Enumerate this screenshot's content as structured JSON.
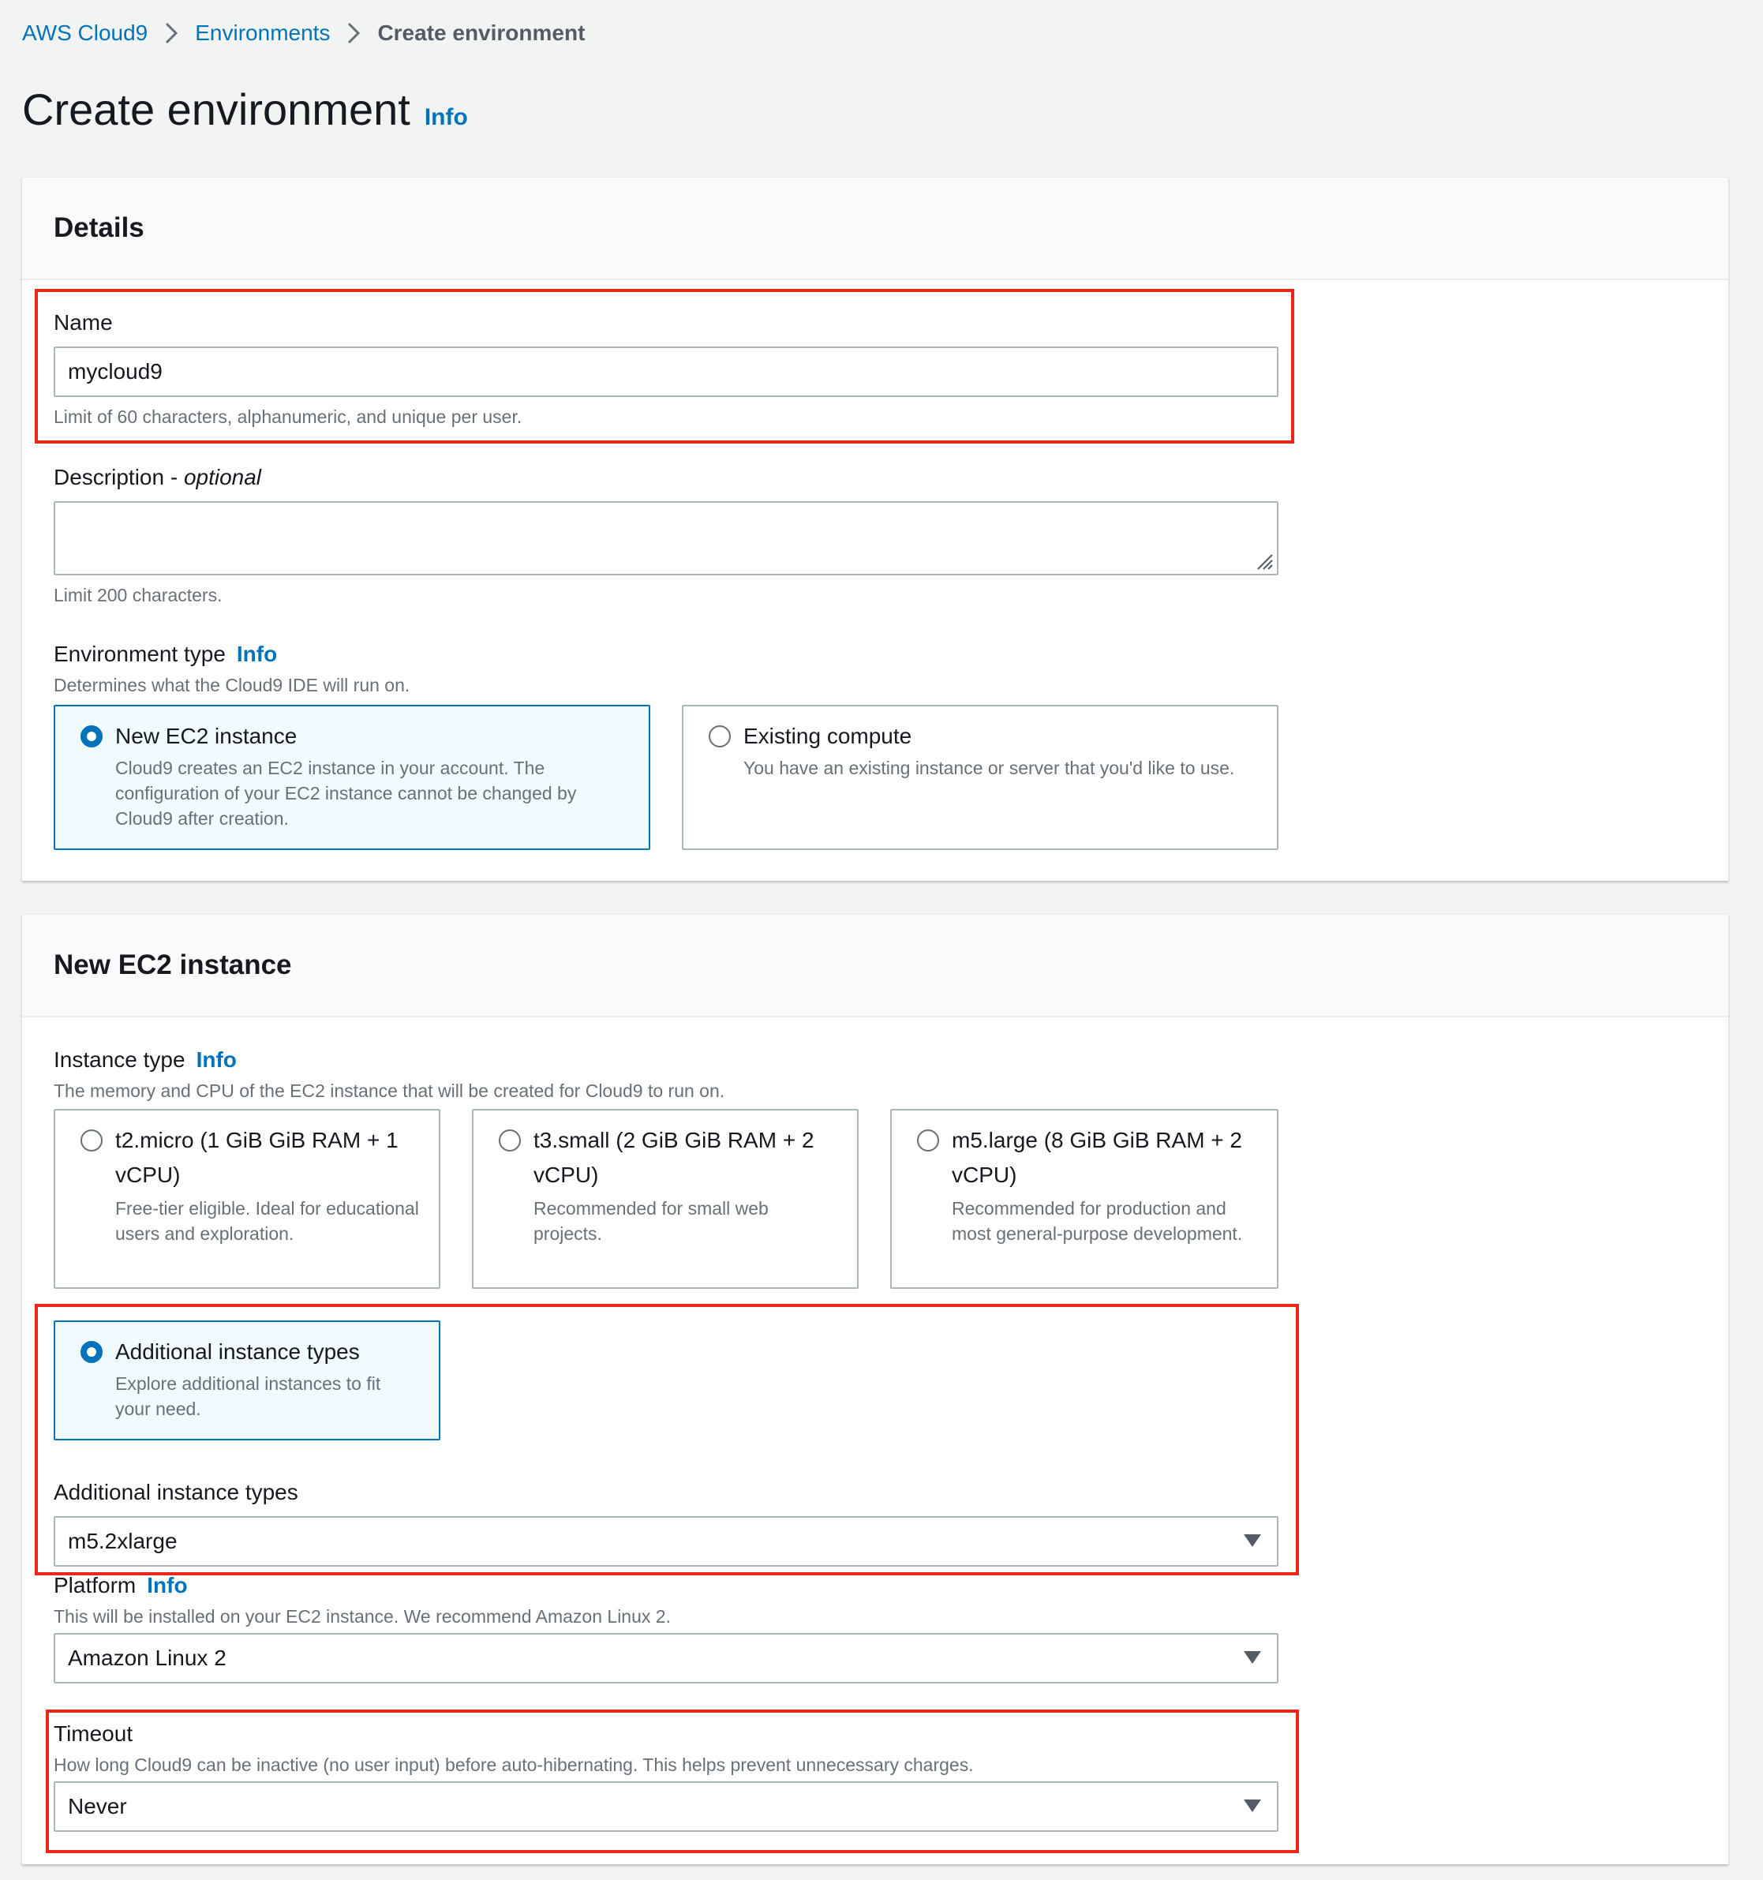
{
  "breadcrumb": {
    "items": [
      "AWS Cloud9",
      "Environments"
    ],
    "current": "Create environment"
  },
  "page": {
    "title": "Create environment",
    "info": "Info"
  },
  "details": {
    "title": "Details",
    "name": {
      "label": "Name",
      "value": "mycloud9",
      "hint": "Limit of 60 characters, alphanumeric, and unique per user."
    },
    "description": {
      "label": "Description - ",
      "label_optional": "optional",
      "value": "",
      "hint": "Limit 200 characters."
    },
    "environment_type": {
      "label": "Environment type",
      "info": "Info",
      "hint": "Determines what the Cloud9 IDE will run on.",
      "options": [
        {
          "title": "New EC2 instance",
          "desc": "Cloud9 creates an EC2 instance in your account. The configuration of your EC2 instance cannot be changed by Cloud9 after creation.",
          "selected": true
        },
        {
          "title": "Existing compute",
          "desc": "You have an existing instance or server that you'd like to use.",
          "selected": false
        }
      ]
    }
  },
  "ec2": {
    "title": "New EC2 instance",
    "instance_type": {
      "label": "Instance type",
      "info": "Info",
      "hint": "The memory and CPU of the EC2 instance that will be created for Cloud9 to run on.",
      "options": [
        {
          "title_line1": "t2.micro (1 GiB GiB RAM + 1",
          "title_line2": "vCPU)",
          "desc": "Free-tier eligible. Ideal for educational users and exploration.",
          "selected": false
        },
        {
          "title_line1": "t3.small (2 GiB GiB RAM + 2",
          "title_line2": "vCPU)",
          "desc": "Recommended for small web projects.",
          "selected": false
        },
        {
          "title_line1": "m5.large (8 GiB GiB RAM + 2",
          "title_line2": "vCPU)",
          "desc": "Recommended for production and most general-purpose development.",
          "selected": false
        }
      ],
      "additional": {
        "title": "Additional instance types",
        "desc": "Explore additional instances to fit your need.",
        "selected": true
      }
    },
    "additional_types": {
      "label": "Additional instance types",
      "value": "m5.2xlarge"
    },
    "platform": {
      "label": "Platform",
      "info": "Info",
      "hint": "This will be installed on your EC2 instance. We recommend Amazon Linux 2.",
      "value": "Amazon Linux 2"
    },
    "timeout": {
      "label": "Timeout",
      "hint": "How long Cloud9 can be inactive (no user input) before auto-hibernating. This helps prevent unnecessary charges.",
      "value": "Never"
    }
  },
  "colors": {
    "link": "#0073bb",
    "highlight": "#e8281a",
    "selected_tile_bg": "#f1faff"
  }
}
